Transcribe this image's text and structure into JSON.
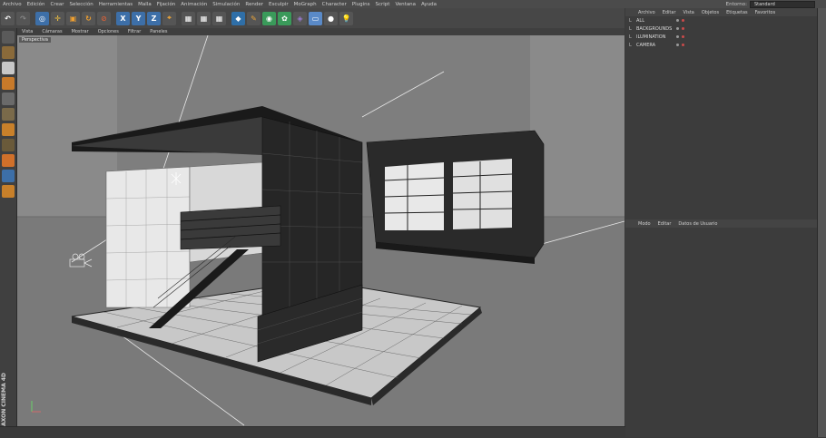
{
  "menu": [
    "Archivo",
    "Edición",
    "Crear",
    "Selección",
    "Herramientas",
    "Malla",
    "Fijación",
    "Animación",
    "Simulación",
    "Render",
    "Esculpir",
    "MoGraph",
    "Character",
    "Plugins",
    "Script",
    "Ventana",
    "Ayuda"
  ],
  "environment": {
    "label": "Entorno:",
    "value": "Standard"
  },
  "viewport": {
    "menu": [
      "Vista",
      "Cámaras",
      "Mostrar",
      "Opciones",
      "Filtrar",
      "Paneles"
    ],
    "label": "Perspectiva"
  },
  "objects_panel": {
    "menu": [
      "Archivo",
      "Editar",
      "Vista",
      "Objetos",
      "Etiquetas",
      "Favoritos"
    ],
    "items": [
      {
        "name": "ALL"
      },
      {
        "name": "BACKGROUNDS"
      },
      {
        "name": "ILUMINATION"
      },
      {
        "name": "CAMERA"
      }
    ]
  },
  "attributes_panel": {
    "menu": [
      "Modo",
      "Editar",
      "Datos de Usuario"
    ]
  },
  "brand": "MAXON CINEMA 4D",
  "colors": {
    "accent": "#e8a33a",
    "toolbar_blue": "#3d6fa8",
    "viewport": "#8a8a8a"
  }
}
